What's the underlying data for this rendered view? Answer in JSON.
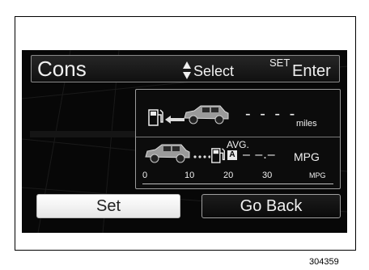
{
  "header": {
    "title": "Cons",
    "select_hint": "Select",
    "set_key": "SET",
    "enter_hint": "Enter"
  },
  "trip": {
    "range_value": "- - - -",
    "range_unit": "miles",
    "avg_label": "AVG.",
    "avg_badge": "A",
    "avg_value": "– –.–",
    "avg_unit": "MPG"
  },
  "scale": {
    "ticks": [
      "0",
      "10",
      "20",
      "30"
    ],
    "unit": "MPG"
  },
  "buttons": {
    "set": "Set",
    "go_back": "Go Back"
  },
  "figure_number": "304359"
}
